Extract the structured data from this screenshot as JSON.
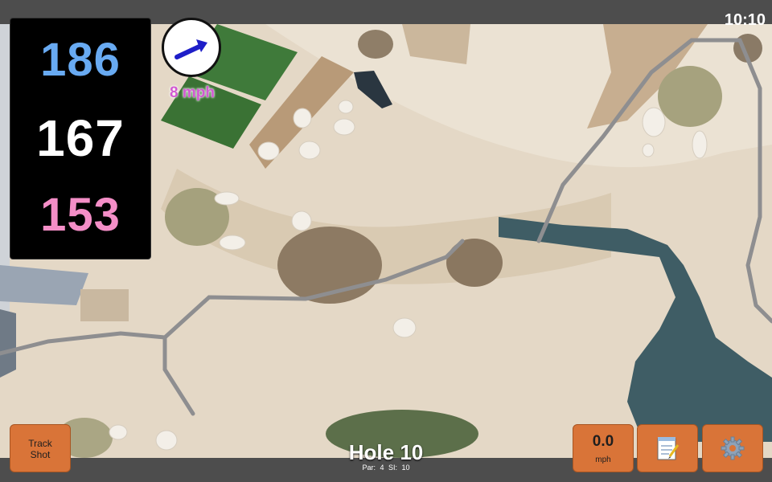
{
  "status": {
    "clock": "10:10"
  },
  "yardages": {
    "back": "186",
    "middle": "167",
    "front": "153"
  },
  "wind": {
    "speed_label": "8 mph",
    "icon": "wind-direction-arrow-icon"
  },
  "buttons": {
    "track_shot_line1": "Track",
    "track_shot_line2": "Shot",
    "speed_value": "0.0",
    "speed_unit": "mph",
    "notes_icon": "notepad-icon",
    "settings_icon": "gear-icon"
  },
  "hole": {
    "title": "Hole 10",
    "par_label": "Par: 4",
    "si_label": "SI: 10"
  },
  "colors": {
    "back_yardage": "#68aaf2",
    "middle_yardage": "#ffffff",
    "front_yardage": "#f48ec7",
    "wind_text": "#d25ad2",
    "button": "#d97438"
  }
}
